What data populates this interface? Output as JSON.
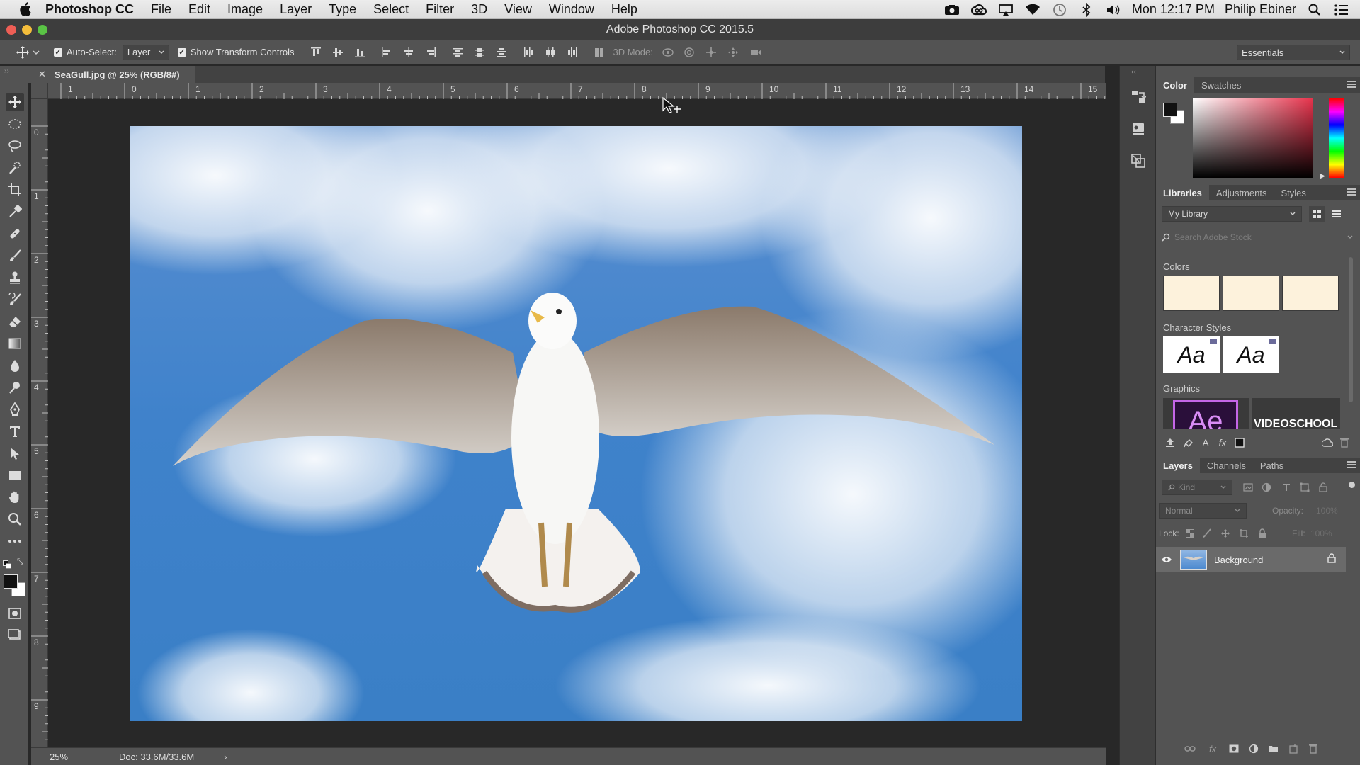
{
  "menubar": {
    "app_name": "Photoshop CC",
    "items": [
      "File",
      "Edit",
      "Image",
      "Layer",
      "Type",
      "Select",
      "Filter",
      "3D",
      "View",
      "Window",
      "Help"
    ],
    "clock": "Mon 12:17 PM",
    "user": "Philip Ebiner"
  },
  "window": {
    "title": "Adobe Photoshop CC 2015.5"
  },
  "options": {
    "auto_select_label": "Auto-Select:",
    "auto_select_value": "Layer",
    "show_transform_label": "Show Transform Controls",
    "mode_3d_label": "3D Mode:",
    "workspace": "Essentials"
  },
  "document": {
    "tab_label": "SeaGull.jpg @ 25% (RGB/8#)",
    "zoom": "25%",
    "doc_size": "Doc: 33.6M/33.6M"
  },
  "rulers": {
    "h_ticks": [
      "1",
      "0",
      "1",
      "2",
      "3",
      "4",
      "5",
      "6",
      "7",
      "8",
      "9",
      "10",
      "11",
      "12",
      "13",
      "14",
      "15"
    ],
    "v_ticks": [
      "0",
      "1",
      "2",
      "3",
      "4",
      "5",
      "6",
      "7",
      "8",
      "9"
    ]
  },
  "color_panel": {
    "tabs": [
      "Color",
      "Swatches"
    ],
    "hue_color": "#e6324b"
  },
  "libraries_panel": {
    "tabs": [
      "Libraries",
      "Adjustments",
      "Styles"
    ],
    "library_name": "My Library",
    "search_placeholder": "Search Adobe Stock",
    "colors_label": "Colors",
    "swatch_colors": [
      "#fdf2dc",
      "#fdf2dc",
      "#fdf2dc"
    ],
    "char_styles_label": "Character Styles",
    "char_styles": [
      "Aa",
      "Aa"
    ],
    "graphics_label": "Graphics",
    "graphic_ae_text": "Ae",
    "graphic_vs_text": "VIDEOSCHOOL"
  },
  "layers_panel": {
    "tabs": [
      "Layers",
      "Channels",
      "Paths"
    ],
    "kind_label": "Kind",
    "blend_mode": "Normal",
    "opacity_label": "Opacity:",
    "opacity_value": "100%",
    "lock_label": "Lock:",
    "fill_label": "Fill:",
    "fill_value": "100%",
    "layers": [
      {
        "name": "Background",
        "visible": true,
        "locked": true
      }
    ]
  }
}
